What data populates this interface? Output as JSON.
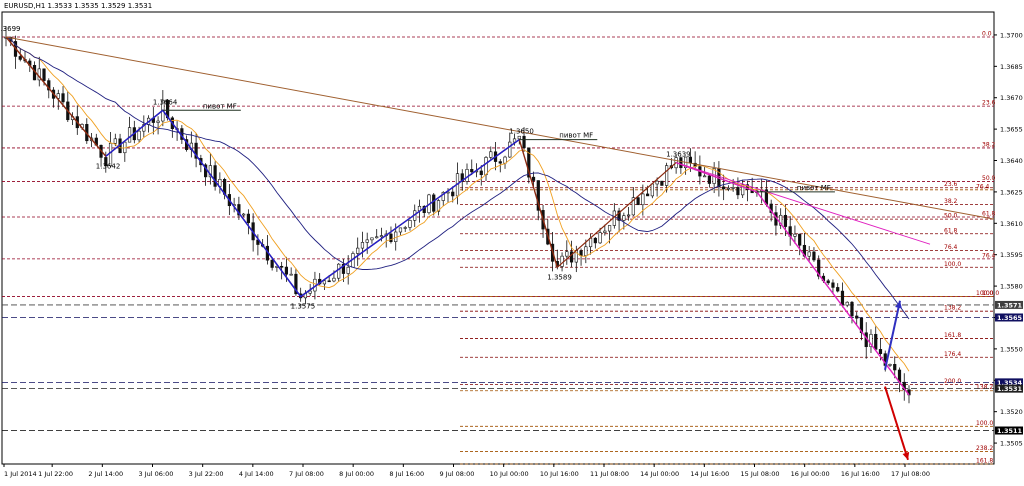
{
  "header": {
    "symbol_line": "EURUSD,H1  1.3533 1.3535 1.3529 1.3531"
  },
  "chart_data": {
    "type": "candlestick",
    "symbol": "EURUSD",
    "timeframe": "H1",
    "ohlc_current": {
      "open": 1.3533,
      "high": 1.3535,
      "low": 1.3529,
      "close": 1.3531
    },
    "ylim": [
      1.3495,
      1.371
    ],
    "y_ticks": [
      "1.3715",
      "1.3700",
      "1.3685",
      "1.3670",
      "1.3655",
      "1.3640",
      "1.3625",
      "1.3610",
      "1.3595",
      "1.3580",
      "1.3565",
      "1.3550",
      "1.3535",
      "1.3520",
      "1.3505"
    ],
    "x_ticks": [
      "1 Jul 2014",
      "1 Jul 22:00",
      "2 Jul 14:00",
      "3 Jul 06:00",
      "3 Jul 22:00",
      "4 Jul 14:00",
      "7 Jul 08:00",
      "8 Jul 00:00",
      "8 Jul 16:00",
      "9 Jul 08:00",
      "10 Jul 00:00",
      "10 Jul 16:00",
      "11 Jul 08:00",
      "14 Jul 00:00",
      "14 Jul 16:00",
      "15 Jul 08:00",
      "16 Jul 00:00",
      "16 Jul 16:00",
      "17 Jul 08:00"
    ],
    "price_labels": [
      {
        "text": "1.3571",
        "value": 1.3571,
        "color": "#404040"
      },
      {
        "text": "1.3565",
        "value": 1.3565,
        "color": "#101060"
      },
      {
        "text": "1.3534",
        "value": 1.3534,
        "color": "#101060"
      },
      {
        "text": "1.3531",
        "value": 1.3531,
        "color": "#202020"
      },
      {
        "text": "1.3511",
        "value": 1.3511,
        "color": "#000000"
      }
    ],
    "swing_labels": [
      {
        "text": "1.3699",
        "x": 0,
        "price": 1.3699
      },
      {
        "text": "1.3664",
        "x": 32,
        "price": 1.3664
      },
      {
        "text": "1.3642",
        "x": 20,
        "price": 1.3642
      },
      {
        "text": "1.3650",
        "x": 104,
        "price": 1.365
      },
      {
        "text": "1.3639",
        "x": 136,
        "price": 1.3639
      },
      {
        "text": "1.3589",
        "x": 112,
        "price": 1.3589
      },
      {
        "text": "1.3575",
        "x": 60,
        "price": 1.3575
      }
    ],
    "pivot_labels": [
      "пивот MF",
      "пивот MF",
      "пивот MF"
    ],
    "fib_levels_1": [
      {
        "label": "0.0",
        "price": 1.3699
      },
      {
        "label": "23.6",
        "price": 1.3666
      },
      {
        "label": "38.2",
        "price": 1.3646
      },
      {
        "label": "50.0",
        "price": 1.363
      },
      {
        "label": "61.8",
        "price": 1.3613
      },
      {
        "label": "76.4",
        "price": 1.3593
      },
      {
        "label": "100.0",
        "price": 1.3575
      }
    ],
    "fib_levels_2": [
      {
        "label": "23.6",
        "price": 1.3627
      },
      {
        "label": "38.2",
        "price": 1.3619
      },
      {
        "label": "50.0",
        "price": 1.3612
      },
      {
        "label": "61.8",
        "price": 1.3605
      },
      {
        "label": "76.4",
        "price": 1.3597
      },
      {
        "label": "100.0",
        "price": 1.3589
      },
      {
        "label": "138.2",
        "price": 1.3568
      },
      {
        "label": "161.8",
        "price": 1.3555
      },
      {
        "label": "176.4",
        "price": 1.3546
      },
      {
        "label": "200.0",
        "price": 1.3533
      }
    ],
    "fib_levels_3": [
      {
        "label": "76.4",
        "price": 1.3626
      },
      {
        "label": "100.0",
        "price": 1.3575
      },
      {
        "label": "138.2",
        "price": 1.353
      },
      {
        "label": "100.0",
        "price": 1.3513
      },
      {
        "label": "238.2",
        "price": 1.3501
      },
      {
        "label": "161.8",
        "price": 1.3495
      }
    ],
    "zigzag": [
      {
        "x": 0,
        "price": 1.3699
      },
      {
        "x": 20,
        "price": 1.3642
      },
      {
        "x": 32,
        "price": 1.3664
      },
      {
        "x": 60,
        "price": 1.3575
      },
      {
        "x": 104,
        "price": 1.365
      },
      {
        "x": 112,
        "price": 1.3589
      },
      {
        "x": 136,
        "price": 1.3639
      },
      {
        "x": 152,
        "price": 1.3625
      },
      {
        "x": 183,
        "price": 1.3528
      }
    ],
    "arrows": [
      {
        "color": "#3030c0",
        "direction": "up",
        "from": 1.354,
        "to": 1.3573
      },
      {
        "color": "#d00000",
        "direction": "down",
        "from": 1.3532,
        "to": 1.3497
      }
    ],
    "colors": {
      "bull": "#101010",
      "bear": "#101010",
      "ma_fast": "#f0a020",
      "ma_slow": "#202080",
      "trend": "#a06030",
      "blue_wave": "#2020d0",
      "brown_wave": "#8b2a10",
      "magenta": "#e020c0",
      "fib": "#800000",
      "fib_text": "#a00000",
      "arrow_up": "#3030c0",
      "arrow_down": "#d00000"
    }
  }
}
